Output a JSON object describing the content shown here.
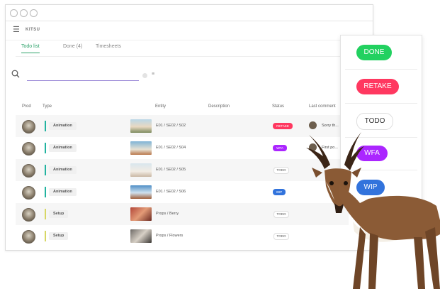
{
  "window": {
    "logo_text": "KITSU"
  },
  "tabs": [
    "Todo list",
    "Done (4)",
    "Timesheets"
  ],
  "search": {
    "value": "",
    "placeholder": ""
  },
  "table": {
    "headers": [
      "Prod",
      "Type",
      "Entity",
      "Description",
      "Status",
      "Last comment"
    ],
    "rows": [
      {
        "type": "Animation",
        "type_color": "#22b3a0",
        "entity": "E01 / SE02 / S02",
        "status": "RETAKE",
        "status_color": "#ff3860",
        "comment": "Sorry th..."
      },
      {
        "type": "Animation",
        "type_color": "#22b3a0",
        "entity": "E01 / SE02 / S04",
        "status": "WFA",
        "status_color": "#ab26ff",
        "comment": "First po..."
      },
      {
        "type": "Animation",
        "type_color": "#22b3a0",
        "entity": "E01 / SE02 / S05",
        "status": "TODO",
        "status_color": "#f5f5f5",
        "comment": ""
      },
      {
        "type": "Animation",
        "type_color": "#22b3a0",
        "entity": "E01 / SE02 / S06",
        "status": "WIP",
        "status_color": "#3273dc",
        "comment": ""
      },
      {
        "type": "Setup",
        "type_color": "#d7d765",
        "entity": "Props / Berry",
        "status": "TODO",
        "status_color": "#f5f5f5",
        "comment": ""
      },
      {
        "type": "Setup",
        "type_color": "#d7d765",
        "entity": "Props / Flowers",
        "status": "TODO",
        "status_color": "#f5f5f5",
        "comment": ""
      }
    ]
  },
  "status_panel": [
    {
      "label": "DONE",
      "bg": "#22d160",
      "fg": "#ffffff"
    },
    {
      "label": "RETAKE",
      "bg": "#ff3860",
      "fg": "#ffffff"
    },
    {
      "label": "TODO",
      "bg": "#ffffff",
      "fg": "#333333"
    },
    {
      "label": "WFA",
      "bg": "#ab26ff",
      "fg": "#ffffff"
    },
    {
      "label": "WIP",
      "bg": "#3273dc",
      "fg": "#ffffff"
    }
  ],
  "icons": [
    "menu-icon",
    "search-icon",
    "filter-icon",
    "avatar",
    "antelope-illustration"
  ]
}
